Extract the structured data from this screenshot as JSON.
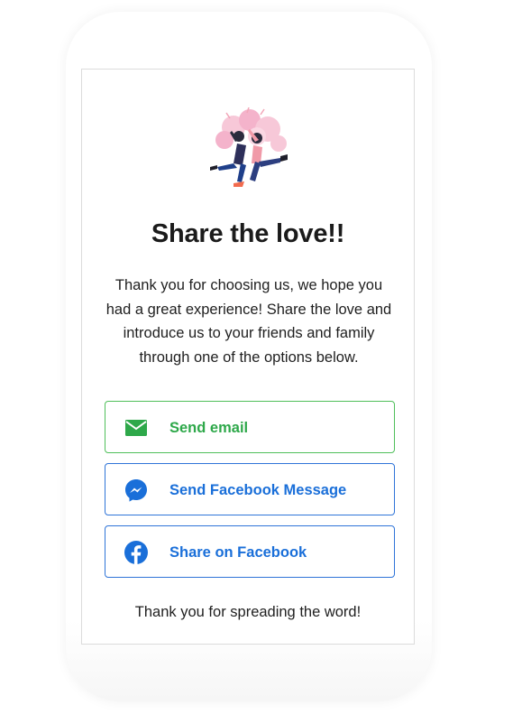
{
  "card": {
    "title": "Share the love!!",
    "message": "Thank you for choosing us, we hope you had a great experience! Share the love and introduce us to your friends and family through one of the options below.",
    "illustration": "two-people-jumping-high-five-illustration",
    "footer": "Thank you for spreading the word!"
  },
  "buttons": {
    "email": {
      "label": "Send email",
      "icon": "envelope-icon",
      "color": "#2ea84a"
    },
    "messenger": {
      "label": "Send Facebook Message",
      "icon": "messenger-icon",
      "color": "#1a6fd9"
    },
    "facebook": {
      "label": "Share on Facebook",
      "icon": "facebook-icon",
      "color": "#1a6fd9"
    }
  }
}
